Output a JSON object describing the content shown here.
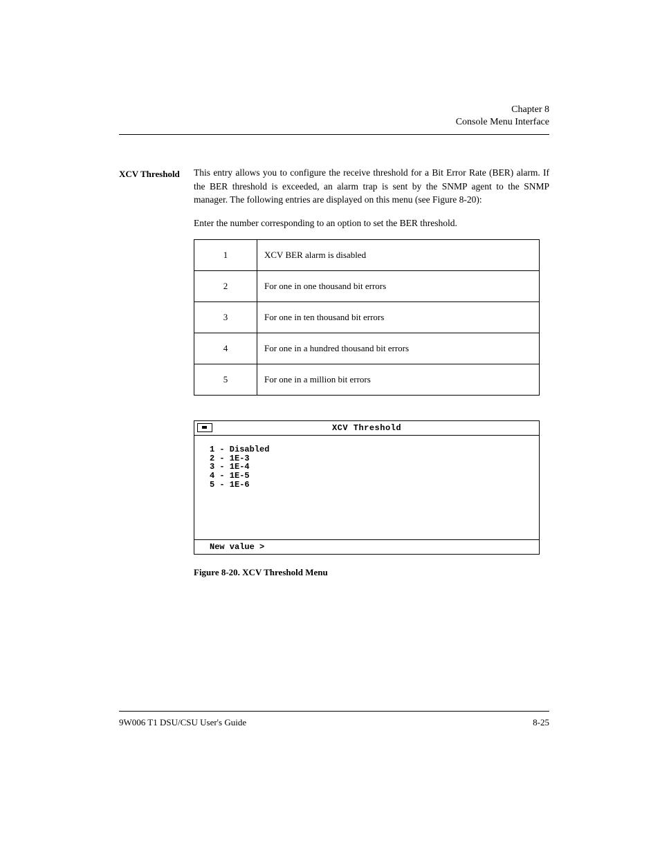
{
  "header": {
    "line1": "Chapter 8",
    "line2": "Console Menu Interface"
  },
  "side_label": "XCV Threshold",
  "body": {
    "p1": "This entry allows you to configure the receive threshold for a Bit Error Rate (BER) alarm. If the BER threshold is exceeded, an alarm trap is sent by the SNMP agent to the SNMP manager. The following entries are displayed on this menu (see Figure 8-20):",
    "p2": "Enter the number corresponding to an option to set the BER threshold.",
    "options": [
      {
        "num": "1",
        "desc": "XCV BER alarm is disabled"
      },
      {
        "num": "2",
        "desc": "For one in one thousand bit errors"
      },
      {
        "num": "3",
        "desc": "For one in ten thousand bit errors"
      },
      {
        "num": "4",
        "desc": "For one in a hundred thousand bit errors"
      },
      {
        "num": "5",
        "desc": "For one in a million bit errors"
      }
    ]
  },
  "terminal": {
    "title": "XCV Threshold",
    "lines": [
      "1 - Disabled",
      "2 - 1E-3",
      "3 - 1E-4",
      "4 - 1E-5",
      "5 - 1E-6"
    ],
    "prompt": "New value >"
  },
  "figure_caption": "Figure 8-20. XCV Threshold Menu",
  "footer": {
    "left": "9W006 T1 DSU/CSU User's Guide",
    "right": "8-25"
  }
}
